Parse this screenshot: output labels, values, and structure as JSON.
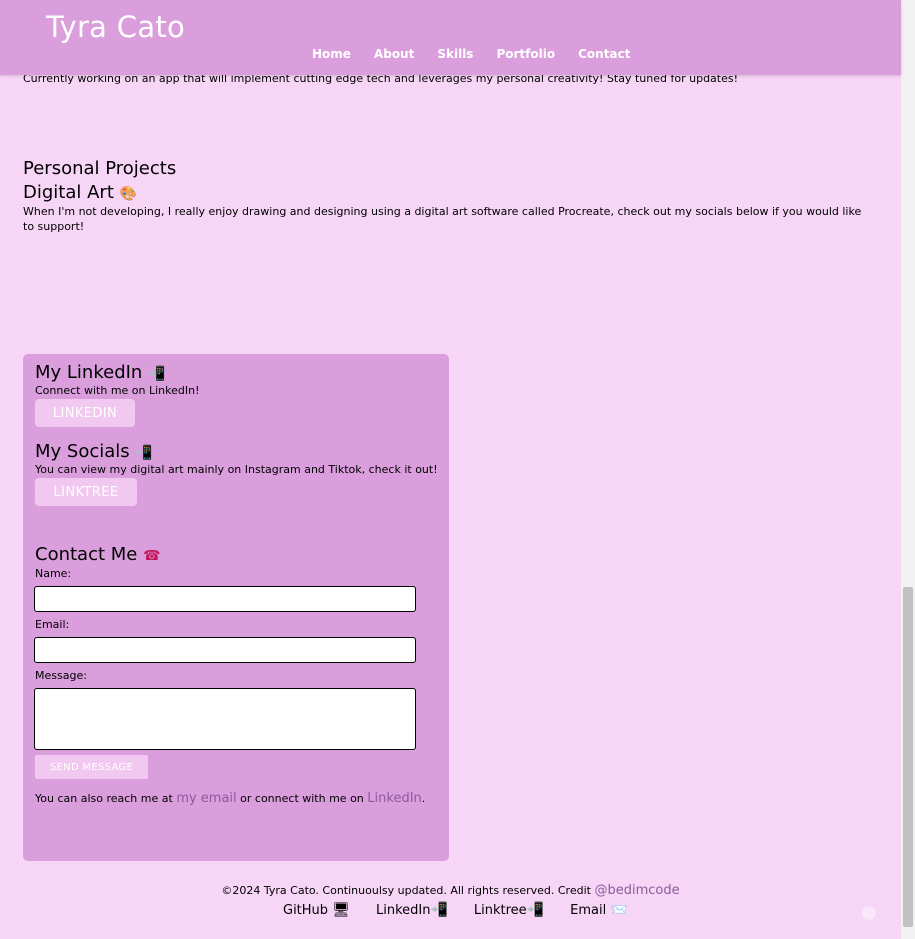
{
  "header": {
    "brand": "Tyra Cato",
    "nav": [
      "Home",
      "About",
      "Skills",
      "Portfolio",
      "Contact"
    ]
  },
  "intro": {
    "text": "Currently working on an app that will implement cutting edge tech and leverages my personal creativity! Stay tuned for updates!"
  },
  "projects": {
    "heading": "Personal Projects",
    "digital_art_title": "Digital Art",
    "digital_art_emoji": "🎨",
    "digital_art_text": "When I'm not developing, I really enjoy drawing and designing using a digital art software called Procreate, check out my socials below if you would like to support!"
  },
  "linkedin_card": {
    "title": "My LinkedIn",
    "emoji": "📲",
    "text": "Connect with me on LinkedIn!",
    "button": "LINKEDIN"
  },
  "socials_card": {
    "title": "My Socials",
    "emoji": "📲",
    "text": "You can view my digital art mainly on Instagram and Tiktok, check it out!",
    "button": "LINKTREE"
  },
  "contact": {
    "title": "Contact Me",
    "emoji": "☎",
    "name_label": "Name:",
    "email_label": "Email:",
    "message_label": "Message:",
    "name_value": "",
    "email_value": "",
    "message_value": "",
    "send_button": "SEND MESSAGE",
    "reach_prefix": "You can also reach me at",
    "reach_email_link": "my email",
    "reach_middle": "or connect with me on",
    "reach_linkedin_link": "LinkedIn",
    "reach_suffix": "."
  },
  "footer": {
    "copyright": "©2024 Tyra Cato. Continuoulsy updated. All rights reserved. Credit",
    "credit_link": "@bedimcode",
    "links": [
      {
        "label": "GitHub",
        "emoji": "🖥"
      },
      {
        "label": "LinkedIn",
        "emoji": "📲"
      },
      {
        "label": "Linktree",
        "emoji": "📲"
      },
      {
        "label": "Email",
        "emoji": "📨"
      }
    ]
  },
  "colors": {
    "page_bg": "#f7d5f6",
    "header_bg": "#da9edc",
    "panel_bg": "#da9edc",
    "pill_bg": "#f1c8f0",
    "link_color": "#8b5a9a"
  }
}
